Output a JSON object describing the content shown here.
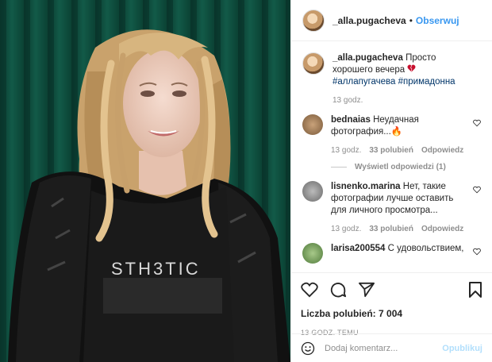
{
  "header": {
    "username": "_alla.pugacheva",
    "separator": "•",
    "follow_label": "Obserwuj"
  },
  "caption": {
    "username": "_alla.pugacheva",
    "text": "Просто хорошего вечера",
    "tags": "#аллапугачева #примадонна",
    "time": "13 godz."
  },
  "comments": [
    {
      "username": "bednaias",
      "text": "Неудачная фотография...",
      "time": "13 godz.",
      "likes": "33 polubień",
      "reply": "Odpowiedz"
    },
    {
      "username": "lisnenko.marina",
      "text": "Нет, такие фотографии лучше оставить для личного просмотра...",
      "time": "13 godz.",
      "likes": "33 polubień",
      "reply": "Odpowiedz"
    },
    {
      "username": "larisa200554",
      "text": "С удовольствием,",
      "time": "",
      "likes": "",
      "reply": ""
    }
  ],
  "view_replies": "Wyświetl odpowiedzi (1)",
  "likes_line": {
    "label": "Liczba polubień:",
    "count": "7 004"
  },
  "timestamp": "13 GODZ. TEMU",
  "add_comment": {
    "placeholder": "Dodaj komentarz...",
    "publish_label": "Opublikuj"
  },
  "photo": {
    "shirt_text": "STH3TIC"
  },
  "colors": {
    "link": "#3897f0",
    "heart": "#ed4956",
    "curtain": "#0e4a3c"
  },
  "icons": [
    "heart-icon",
    "comment-icon",
    "share-icon",
    "bookmark-icon",
    "emoji-icon"
  ]
}
